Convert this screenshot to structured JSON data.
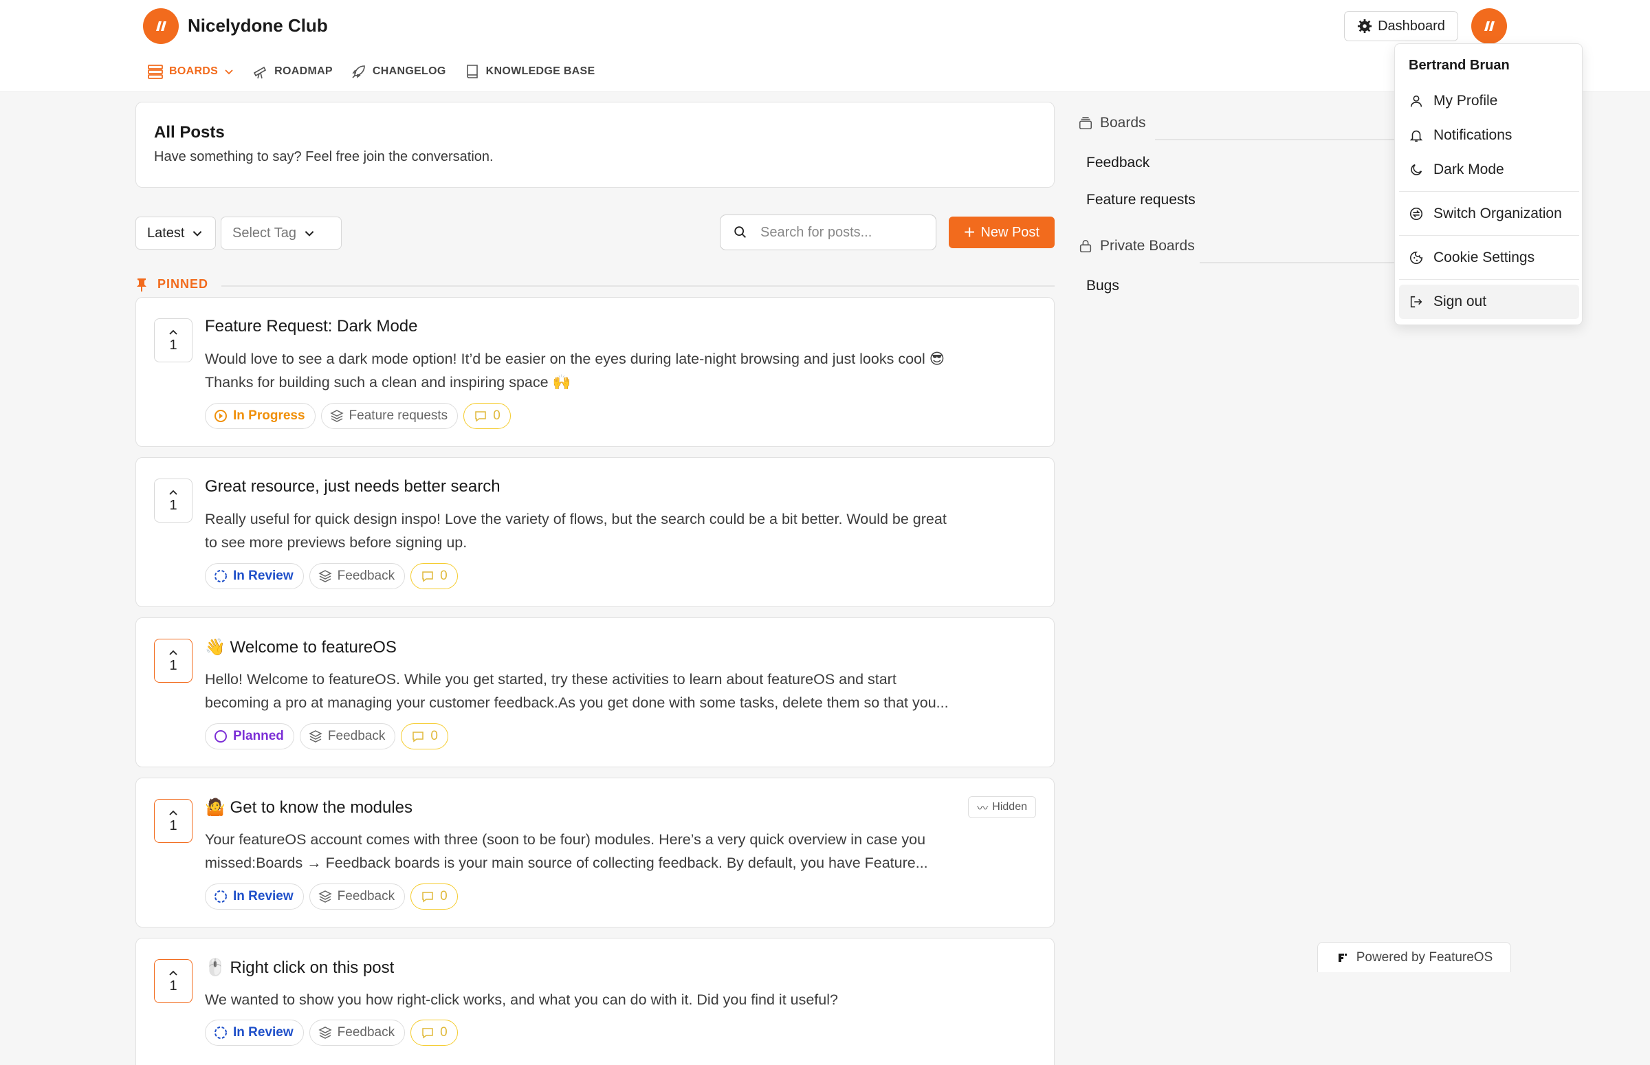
{
  "brand": {
    "name": "Nicelydone Club",
    "accent": "#f26b1d"
  },
  "nav": {
    "items": [
      {
        "label": "BOARDS",
        "icon": "boards-icon",
        "active": true
      },
      {
        "label": "ROADMAP",
        "icon": "telescope-icon"
      },
      {
        "label": "CHANGELOG",
        "icon": "rocket-icon"
      },
      {
        "label": "KNOWLEDGE BASE",
        "icon": "book-icon"
      }
    ]
  },
  "header": {
    "dashboard_label": "Dashboard"
  },
  "user_menu": {
    "user_name": "Bertrand Bruan",
    "items": [
      {
        "label": "My Profile",
        "icon": "user-icon"
      },
      {
        "label": "Notifications",
        "icon": "bell-icon"
      },
      {
        "label": "Dark Mode",
        "icon": "moon-icon"
      },
      {
        "label": "Switch Organization",
        "icon": "switch-icon"
      },
      {
        "label": "Cookie Settings",
        "icon": "cookie-icon"
      },
      {
        "label": "Sign out",
        "icon": "sign-out-icon"
      }
    ]
  },
  "main": {
    "title": "All Posts",
    "subtitle": "Have something to say? Feel free join the conversation.",
    "sort_label": "Latest",
    "tag_placeholder": "Select Tag",
    "search_placeholder": "Search for posts...",
    "new_post_label": "New Post",
    "pinned_label": "PINNED"
  },
  "posts": [
    {
      "title": "Feature Request: Dark Mode",
      "body": [
        "Would love to see a dark mode option! It’d be easier on the eyes during late-night browsing and just looks cool 😎",
        "Thanks for building such a clean and inspiring space 🙌"
      ],
      "votes": "1",
      "status": "In Progress",
      "status_color": "#f0900a",
      "board": "Feature requests",
      "comments": "0"
    },
    {
      "title": "Great resource, just needs better search",
      "body": [
        "Really useful for quick design inspo! Love the variety of flows, but the search could be a bit better. Would be great",
        "to see more previews before signing up."
      ],
      "votes": "1",
      "status": "In Review",
      "status_color": "#1e4fc9",
      "board": "Feedback",
      "comments": "0"
    },
    {
      "title": "👋 Welcome to featureOS",
      "body": [
        "Hello! Welcome to featureOS. While you get started, try these activities to learn about featureOS and start",
        "becoming a pro at managing your customer feedback.As you get done with some tasks, delete them so that you..."
      ],
      "votes": "1",
      "status": "Planned",
      "status_color": "#7c2fd6",
      "board": "Feedback",
      "comments": "0"
    },
    {
      "title": "🤷 Get to know the modules",
      "body": [
        "Your featureOS account comes with three (soon to be four) modules. Here’s a very quick overview in case you",
        "missed:Boards → Feedback boards is your main source of collecting feedback. By default, you have Feature..."
      ],
      "votes": "1",
      "status": "In Review",
      "status_color": "#1e4fc9",
      "board": "Feedback",
      "comments": "0",
      "badge": "Hidden"
    },
    {
      "title": "🖱️ Right click on this post",
      "body": [
        "We wanted to show you how right-click works, and what you can do with it. Did you find it useful?"
      ],
      "votes": "1",
      "status": "In Review",
      "status_color": "#1e4fc9",
      "board": "Feedback",
      "comments": "0"
    }
  ],
  "sidebar": {
    "boards_heading": "Boards",
    "boards": [
      "Feedback",
      "Feature requests"
    ],
    "private_heading": "Private Boards",
    "private_boards": [
      "Bugs"
    ]
  },
  "footer": {
    "powered_by": "Powered by FeatureOS"
  }
}
